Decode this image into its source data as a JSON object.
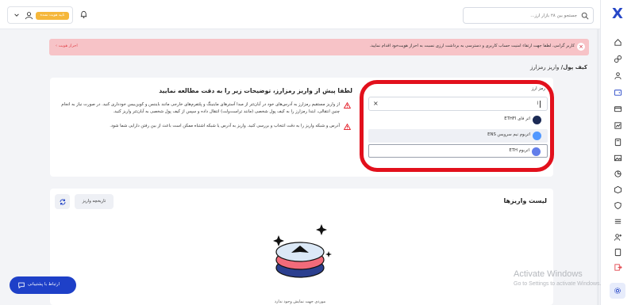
{
  "header": {
    "search_placeholder": "جستجو بین ۲۸ بازار ارز...",
    "user_badge": "تایید هویت نشده"
  },
  "alert": {
    "message": "کاربر گرامی، لطفا جهت ارتقاء امنیت حساب کاربری و دسترسی به برداشت ارزی نسبت به احراز هویت‌خود اقدام نمایید.",
    "link_label": "احراز هویت"
  },
  "breadcrumb": {
    "parent": "کیف پول/",
    "current": "واریز رمزارز"
  },
  "info": {
    "title": "لطفا پیش از واریز رمزارز، توضیحات زیر را به دقت مطالعه نمایید",
    "line1": "از واریز مستقیم رمزارز به آدرس‌های خود در آبان‌تتر از مبدا آسترهای ماینینگ و پلتفرم‌های خارجی مانند بایننس و کوین‌بیس خودداری کنید. در صورت نیاز به انجام چنین انتقالی، ابتدا رمزارز را به کیف پول شخصی (مانند تراست‌ولت) انتقال داده و سپس از کیف پول شخصی به آبان‌تتر واریز کنید.",
    "line2": "آدرس و شبکه واریز را به دقت انتخاب و بررسی کنید. واریز به آدرس یا شبکه اشتباه ممکن است باعث از بین رفتن دارایی شما شود."
  },
  "selector": {
    "label": "رمز ارز",
    "input_value": "ا",
    "options": [
      {
        "label": "اتر فای",
        "code": "ETHFI"
      },
      {
        "label": "اتریوم نیم سرویس",
        "code": "ENS"
      },
      {
        "label": "اتریوم",
        "code": "ETH"
      }
    ]
  },
  "deposits": {
    "title": "لیست واریزها",
    "history_button": "تاریخچه واریز",
    "empty_text": "موردی جهت نمایش وجود ندارد"
  },
  "support": {
    "label": "ارتباط با پشتیبانی"
  },
  "watermark": {
    "title": "Activate Windows",
    "subtitle": "Go to Settings to activate Windows."
  },
  "colors": {
    "accent": "#1e40c8",
    "alert_bg": "#f7c3c7",
    "highlight_ring": "#e2101c",
    "badge": "#f5b73b"
  }
}
